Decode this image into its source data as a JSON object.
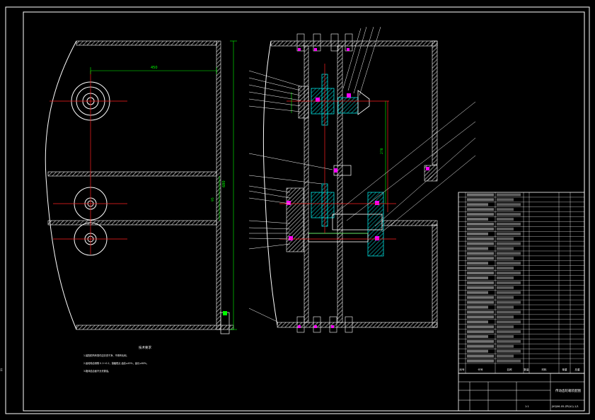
{
  "sheet": {
    "background": "#000000",
    "frame_color": "#ffffff",
    "centerline_color": "#ff2020",
    "dimension_color": "#00ff00",
    "part_color": "#00d0d0",
    "hatch_color": "#ffffff",
    "bolt_color": "#ff00ff"
  },
  "title_block": {
    "title": "传动齿轮箱装配图",
    "drawing_no": "JXSJ06-05-ZP(A1)-1/1",
    "scale": "1:1",
    "sheet": "1",
    "notes_heading": "技术要求",
    "notes": [
      "1.装配前所有零件应清洗干净，不得有毛刺。",
      "2.齿轮啮合侧隙 0.1～0.2，接触斑点 齿高≥45%，齿长≥60%。",
      "3.箱体结合面不允许漏油。"
    ],
    "bom_header": [
      "序号",
      "代号",
      "名称",
      "数量",
      "材料",
      "单重",
      "总重",
      "备注"
    ]
  },
  "dimensions": {
    "top_width": "450",
    "total_height": "680",
    "middle": "95",
    "center": "278"
  }
}
